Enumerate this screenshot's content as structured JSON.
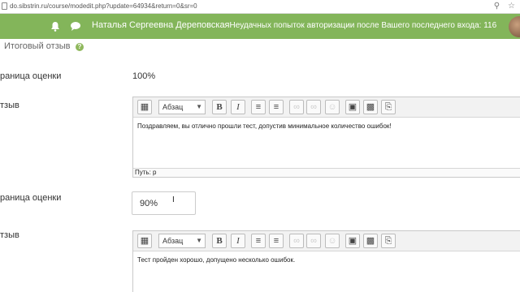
{
  "browser": {
    "url": "do.sibstrin.ru/course/modedit.php?update=64934&return=0&sr=0"
  },
  "header": {
    "user_name": "Наталья Сергеевна Дереповская",
    "login_info": "Неудачных попыток авторизации после Вашего последнего входа: 116"
  },
  "section": {
    "title": "Итоговый отзыв"
  },
  "feedback_1": {
    "boundary_label": "раница оценки",
    "boundary_value": "100%",
    "feedback_label": "тзыв",
    "editor": {
      "format": "Абзац",
      "text": "Поздравляем, вы отлично прошли тест, допустив минимальное количество ошибок!",
      "path": "Путь: p"
    }
  },
  "feedback_2": {
    "boundary_label": "раница оценки",
    "boundary_value": "90%",
    "feedback_label": "тзыв",
    "editor": {
      "format": "Абзац",
      "text": "Тест пройден хорошо, допущено несколько ошибок."
    }
  },
  "colors": {
    "header_bg": "#83b55a",
    "help_icon": "#8fb85c"
  }
}
